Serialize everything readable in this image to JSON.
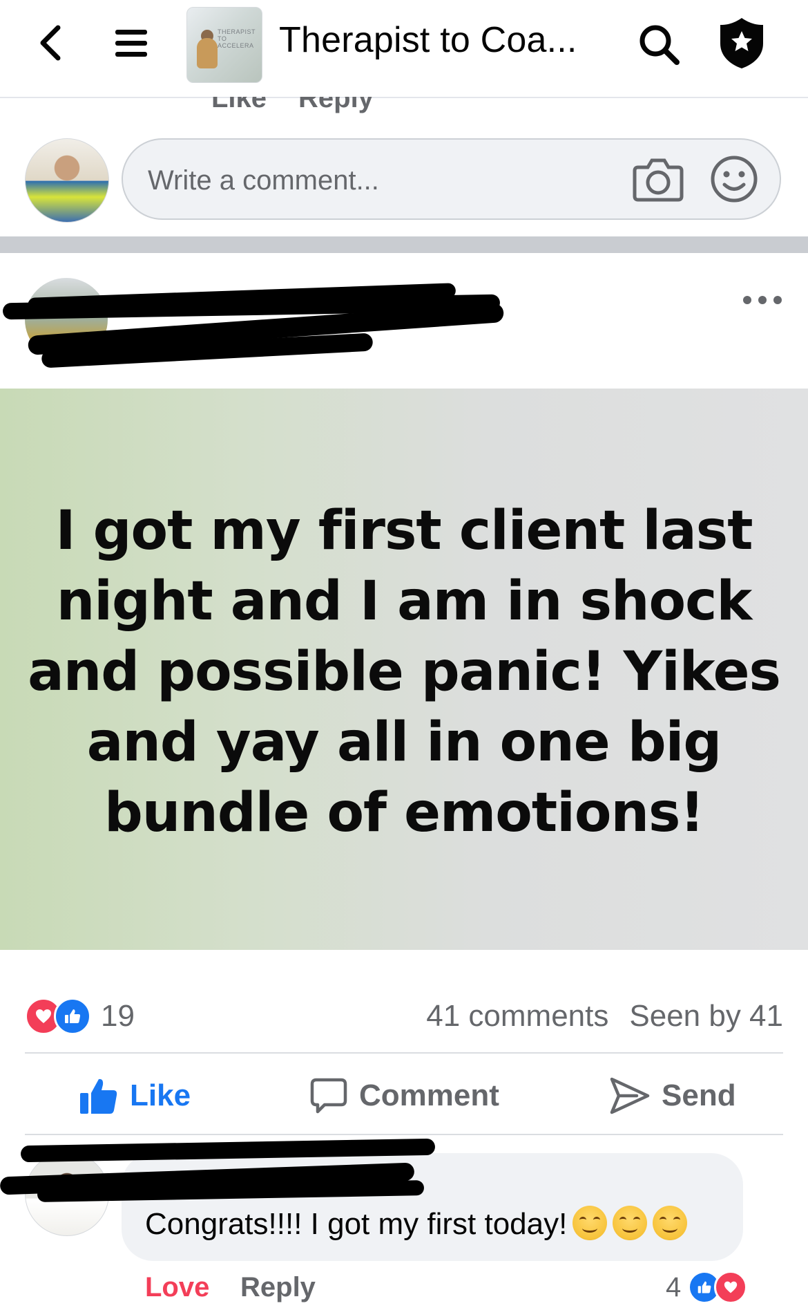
{
  "header": {
    "title": "Therapist to Coa...",
    "group_thumb_text": "THERAPIST TO ACCELERA"
  },
  "prev_comment_actions": {
    "like": "Like",
    "reply": "Reply"
  },
  "composer": {
    "placeholder": "Write a comment..."
  },
  "post": {
    "body": "I got my first client last night and I am in shock and possible panic! Yikes and yay all in one big bundle of emotions!",
    "reaction_count": "19",
    "comments": "41 comments",
    "seen_by": "Seen by 41"
  },
  "actions": {
    "like": "Like",
    "comment": "Comment",
    "send": "Send"
  },
  "comment": {
    "text": "Congrats!!!! I got my first today!",
    "love": "Love",
    "reply": "Reply",
    "reaction_count": "4"
  },
  "colors": {
    "like_blue": "#1877f2",
    "love_red": "#f33e58",
    "muted": "#65676b"
  }
}
